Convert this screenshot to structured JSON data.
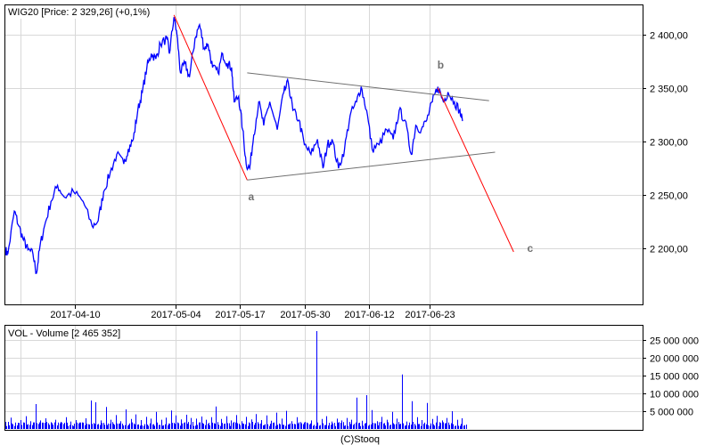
{
  "chart_data": [
    {
      "type": "line",
      "title": "WIG20 [Price: 2 329,26] (+0,1%)",
      "x_unit": "trading session index",
      "xlim": [
        0,
        127
      ],
      "ylim": [
        2148,
        2427
      ],
      "grid": true,
      "y_ticks": [
        2200,
        2250,
        2300,
        2350,
        2400
      ],
      "y_tick_labels": [
        "2 200,00",
        "2 250,00",
        "2 300,00",
        "2 350,00",
        "2 400,00"
      ],
      "x_ticks": [
        13.8,
        34,
        46.7,
        59.6,
        72.5,
        84.5
      ],
      "x_tick_labels": [
        "2017-04-10",
        "2017-05-04",
        "2017-05-17",
        "2017-05-30",
        "2017-06-12",
        "2017-06-23"
      ],
      "series": [
        {
          "name": "WIG20",
          "color": "#0000ff",
          "points": [
            [
              0,
              2199
            ],
            [
              0.5,
              2195
            ],
            [
              1.8,
              2235
            ],
            [
              2.7,
              2221
            ],
            [
              3.6,
              2208
            ],
            [
              4.5,
              2199
            ],
            [
              5.5,
              2195
            ],
            [
              6.2,
              2177
            ],
            [
              6.9,
              2202
            ],
            [
              7.8,
              2221
            ],
            [
              9.1,
              2244
            ],
            [
              10.4,
              2259
            ],
            [
              11.8,
              2248
            ],
            [
              13.6,
              2253
            ],
            [
              15.5,
              2244
            ],
            [
              17.3,
              2221
            ],
            [
              18.5,
              2226
            ],
            [
              19.6,
              2253
            ],
            [
              20.9,
              2271
            ],
            [
              22.2,
              2288
            ],
            [
              23.6,
              2279
            ],
            [
              24.5,
              2293
            ],
            [
              25.5,
              2302
            ],
            [
              26.4,
              2329
            ],
            [
              27.3,
              2346
            ],
            [
              28.2,
              2369
            ],
            [
              29.1,
              2382
            ],
            [
              30,
              2377
            ],
            [
              30.9,
              2391
            ],
            [
              32.2,
              2396
            ],
            [
              32.7,
              2382
            ],
            [
              33.6,
              2416
            ],
            [
              34.2,
              2400
            ],
            [
              34.9,
              2364
            ],
            [
              35.8,
              2373
            ],
            [
              36.7,
              2360
            ],
            [
              37.8,
              2396
            ],
            [
              38.7,
              2409
            ],
            [
              39.6,
              2387
            ],
            [
              40.4,
              2391
            ],
            [
              41.3,
              2369
            ],
            [
              42.4,
              2364
            ],
            [
              43.3,
              2382
            ],
            [
              44.2,
              2373
            ],
            [
              45.1,
              2369
            ],
            [
              45.6,
              2337
            ],
            [
              46.5,
              2342
            ],
            [
              47.3,
              2311
            ],
            [
              48,
              2279
            ],
            [
              48.7,
              2275
            ],
            [
              49.5,
              2306
            ],
            [
              50.5,
              2337
            ],
            [
              51.5,
              2315
            ],
            [
              52.7,
              2337
            ],
            [
              54.2,
              2311
            ],
            [
              55.5,
              2346
            ],
            [
              56.4,
              2355
            ],
            [
              57.3,
              2329
            ],
            [
              58.5,
              2320
            ],
            [
              59.6,
              2297
            ],
            [
              60.9,
              2288
            ],
            [
              62.2,
              2302
            ],
            [
              63.3,
              2275
            ],
            [
              64.2,
              2297
            ],
            [
              65.1,
              2302
            ],
            [
              66.4,
              2275
            ],
            [
              67.6,
              2293
            ],
            [
              68.7,
              2324
            ],
            [
              70,
              2337
            ],
            [
              70.9,
              2351
            ],
            [
              72,
              2329
            ],
            [
              73.1,
              2293
            ],
            [
              74.5,
              2297
            ],
            [
              76,
              2311
            ],
            [
              77.3,
              2302
            ],
            [
              78.5,
              2329
            ],
            [
              79.6,
              2320
            ],
            [
              80.9,
              2288
            ],
            [
              81.8,
              2315
            ],
            [
              82.9,
              2311
            ],
            [
              84,
              2320
            ],
            [
              85.1,
              2337
            ],
            [
              86.2,
              2351
            ],
            [
              87.3,
              2337
            ],
            [
              88.2,
              2346
            ],
            [
              89.5,
              2337
            ],
            [
              90.5,
              2329
            ],
            [
              91.1,
              2319
            ]
          ]
        }
      ],
      "trend_lines": [
        {
          "color": "#ff0000",
          "from": [
            33.6,
            2418
          ],
          "to": [
            48.2,
            2264
          ]
        },
        {
          "color": "#ff0000",
          "from": [
            86.2,
            2350
          ],
          "to": [
            101.3,
            2197
          ]
        },
        {
          "color": "#707070",
          "from": [
            48.2,
            2364
          ],
          "to": [
            96.4,
            2338
          ]
        },
        {
          "color": "#707070",
          "from": [
            48.2,
            2264
          ],
          "to": [
            97.6,
            2290
          ]
        }
      ],
      "annotations": [
        {
          "text": "a",
          "at": [
            48.4,
            2245
          ]
        },
        {
          "text": "b",
          "at": [
            86.1,
            2368
          ]
        },
        {
          "text": "c",
          "at": [
            104,
            2197
          ]
        }
      ]
    },
    {
      "type": "bar",
      "title": "VOL - Volume [2 465 352]",
      "color": "#0000ff",
      "ylim": [
        0,
        29000000
      ],
      "y_ticks": [
        5000000,
        10000000,
        15000000,
        20000000,
        25000000
      ],
      "y_tick_labels": [
        "5 000 000",
        "10 000 000",
        "15 000 000",
        "20 000 000",
        "25 000 000"
      ],
      "volume_millions": [
        2.0,
        3.2,
        1.8,
        2.5,
        3.6,
        2.2,
        7.0,
        2.4,
        3.0,
        1.9,
        2.6,
        2.0,
        3.3,
        2.1,
        2.5,
        1.8,
        3.0,
        8.0,
        7.5,
        2.4,
        6.2,
        2.6,
        3.9,
        2.2,
        5.5,
        2.8,
        4.1,
        2.5,
        3.4,
        2.9,
        4.8,
        2.6,
        3.2,
        5.2,
        3.8,
        2.7,
        4.0,
        3.1,
        2.9,
        3.5,
        2.6,
        3.3,
        6.3,
        2.8,
        3.6,
        2.4,
        3.9,
        2.2,
        3.4,
        2.7,
        4.2,
        2.5,
        3.8,
        2.3,
        4.6,
        2.9,
        5.1,
        2.2,
        3.3,
        1.6,
        1.8,
        2.4,
        27.5,
        2.8,
        3.6,
        2.1,
        2.9,
        2.4,
        3.1,
        2.6,
        8.8,
        2.3,
        9.5,
        5.3,
        2.2,
        3.4,
        2.6,
        4.8,
        2.9,
        15.3,
        2.1,
        7.8,
        3.3,
        2.5,
        7.3,
        2.8,
        3.7,
        2.4,
        3.1,
        5.0,
        2.6,
        3.0
      ],
      "footer": "(C)Stooq"
    }
  ]
}
